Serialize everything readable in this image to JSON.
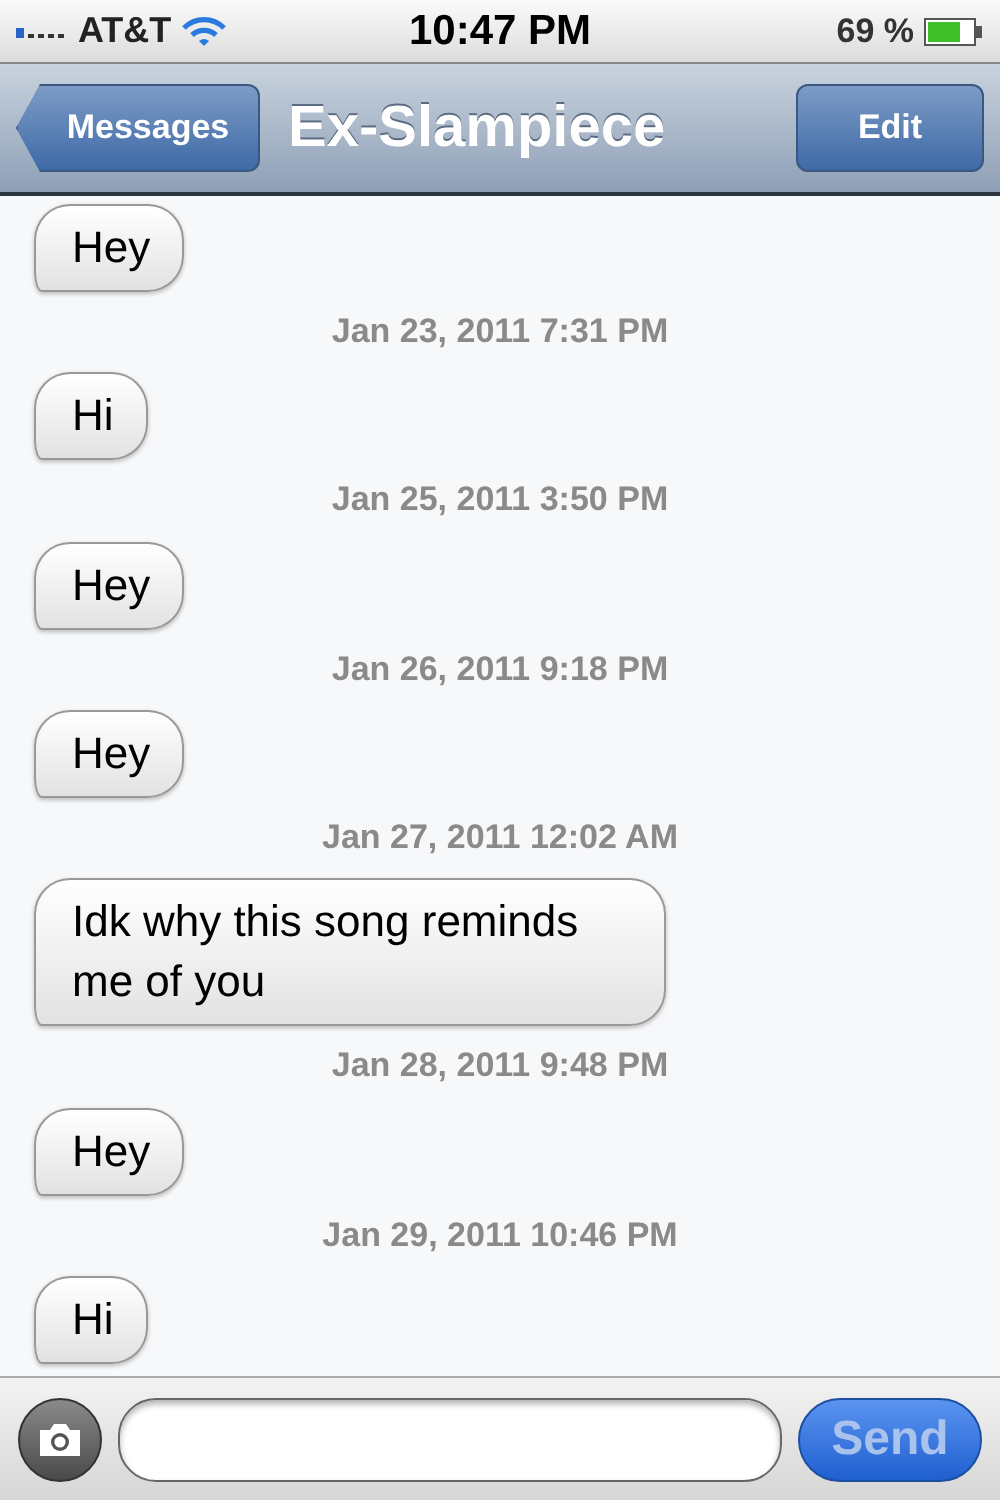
{
  "status_bar": {
    "carrier": "AT&T",
    "time": "10:47 PM",
    "battery": "69 %"
  },
  "nav_bar": {
    "back": "Messages",
    "title": "Ex-Slampiece",
    "edit": "Edit"
  },
  "messages": [
    {
      "kind": "bubble",
      "text": "Hey"
    },
    {
      "kind": "timestamp",
      "text": "Jan 23, 2011 7:31 PM"
    },
    {
      "kind": "bubble",
      "text": "Hi"
    },
    {
      "kind": "timestamp",
      "text": "Jan 25, 2011 3:50 PM"
    },
    {
      "kind": "bubble",
      "text": "Hey"
    },
    {
      "kind": "timestamp",
      "text": "Jan 26, 2011 9:18 PM"
    },
    {
      "kind": "bubble",
      "text": "Hey"
    },
    {
      "kind": "timestamp",
      "text": "Jan 27, 2011 12:02 AM"
    },
    {
      "kind": "bubble",
      "text": "Idk why this song reminds me of you"
    },
    {
      "kind": "timestamp",
      "text": "Jan 28, 2011 9:48 PM"
    },
    {
      "kind": "bubble",
      "text": "Hey"
    },
    {
      "kind": "timestamp",
      "text": "Jan 29, 2011 10:46 PM"
    },
    {
      "kind": "bubble",
      "text": "Hi"
    }
  ],
  "composer": {
    "send": {
      "label": "Send",
      "disabled": true
    }
  }
}
